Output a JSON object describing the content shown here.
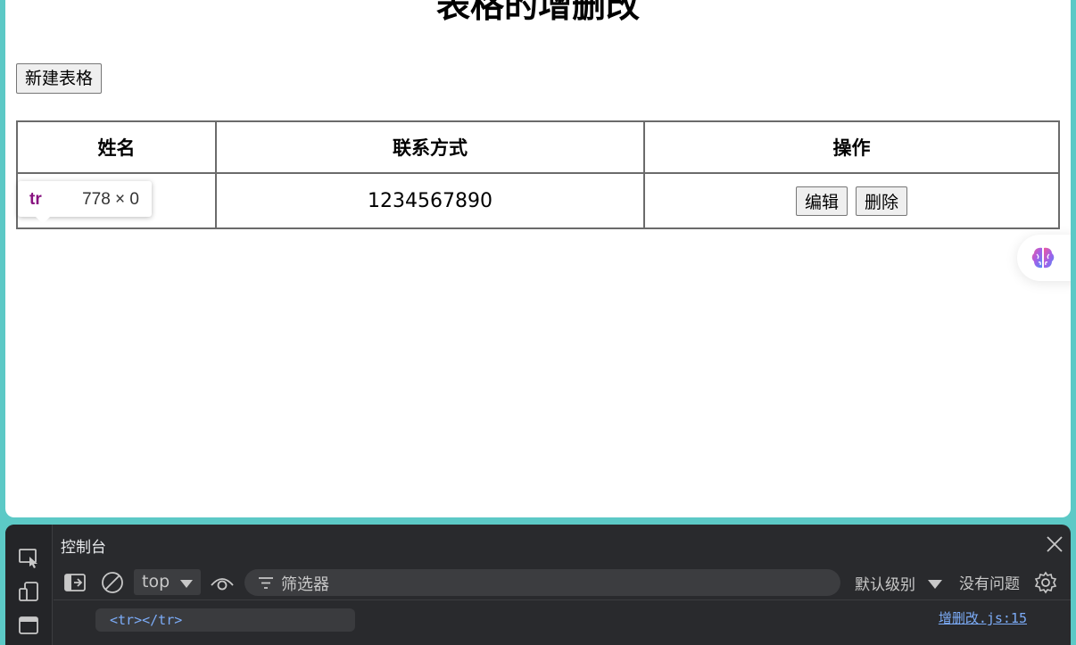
{
  "page": {
    "title": "表格的增删改",
    "new_table_button": "新建表格"
  },
  "table": {
    "headers": [
      "姓名",
      "联系方式",
      "操作"
    ],
    "rows": [
      {
        "name": "",
        "contact": "1234567890",
        "edit_label": "编辑",
        "delete_label": "删除"
      }
    ]
  },
  "inspect_tooltip": {
    "tag": "tr",
    "dimensions": "778 × 0"
  },
  "floating_widget": {
    "icon": "brain-icon"
  },
  "devtools": {
    "panel_title": "控制台",
    "context": "top",
    "filter_placeholder": "筛选器",
    "log_level": "默认级别",
    "issues": "没有问题",
    "console_output": "<tr></tr>",
    "source": "增删改.js:15"
  },
  "colors": {
    "background": "#5cc9c6",
    "devtools_bg": "#292a2d",
    "link": "#7cacf8",
    "tag": "#881280"
  }
}
